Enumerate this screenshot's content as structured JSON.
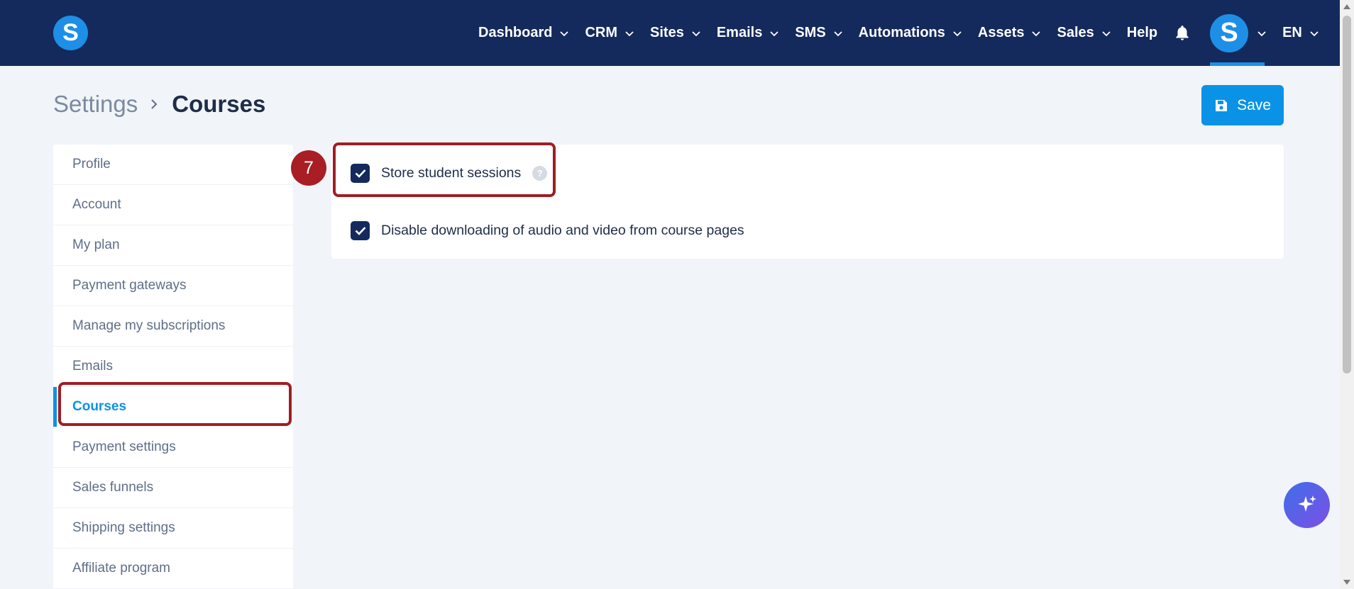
{
  "brand": {
    "logo_letter": "S"
  },
  "nav": {
    "items": [
      {
        "label": "Dashboard",
        "has_dropdown": true
      },
      {
        "label": "CRM",
        "has_dropdown": true
      },
      {
        "label": "Sites",
        "has_dropdown": true
      },
      {
        "label": "Emails",
        "has_dropdown": true
      },
      {
        "label": "SMS",
        "has_dropdown": true
      },
      {
        "label": "Automations",
        "has_dropdown": true
      },
      {
        "label": "Assets",
        "has_dropdown": true
      },
      {
        "label": "Sales",
        "has_dropdown": true
      },
      {
        "label": "Help",
        "has_dropdown": false
      }
    ],
    "notification_icon": "bell-icon",
    "avatar_letter": "S",
    "language": "EN"
  },
  "breadcrumb": {
    "root": "Settings",
    "current": "Courses"
  },
  "toolbar": {
    "save_label": "Save",
    "save_icon": "floppy-disk-icon"
  },
  "sidebar": {
    "items": [
      {
        "label": "Profile"
      },
      {
        "label": "Account"
      },
      {
        "label": "My plan"
      },
      {
        "label": "Payment gateways"
      },
      {
        "label": "Manage my subscriptions"
      },
      {
        "label": "Emails"
      },
      {
        "label": "Courses",
        "active": true
      },
      {
        "label": "Payment settings"
      },
      {
        "label": "Sales funnels"
      },
      {
        "label": "Shipping settings"
      },
      {
        "label": "Affiliate program"
      }
    ]
  },
  "settings": {
    "options": [
      {
        "label": "Store student sessions",
        "checked": true,
        "has_help": true,
        "help_glyph": "?"
      },
      {
        "label": "Disable downloading of audio and video from course pages",
        "checked": true,
        "has_help": false
      }
    ]
  },
  "annotation": {
    "step_number": "7"
  },
  "colors": {
    "topbar": "#142a5c",
    "accent": "#0a93e6",
    "highlight": "#a11d24",
    "page_bg": "#f1f4f8"
  }
}
